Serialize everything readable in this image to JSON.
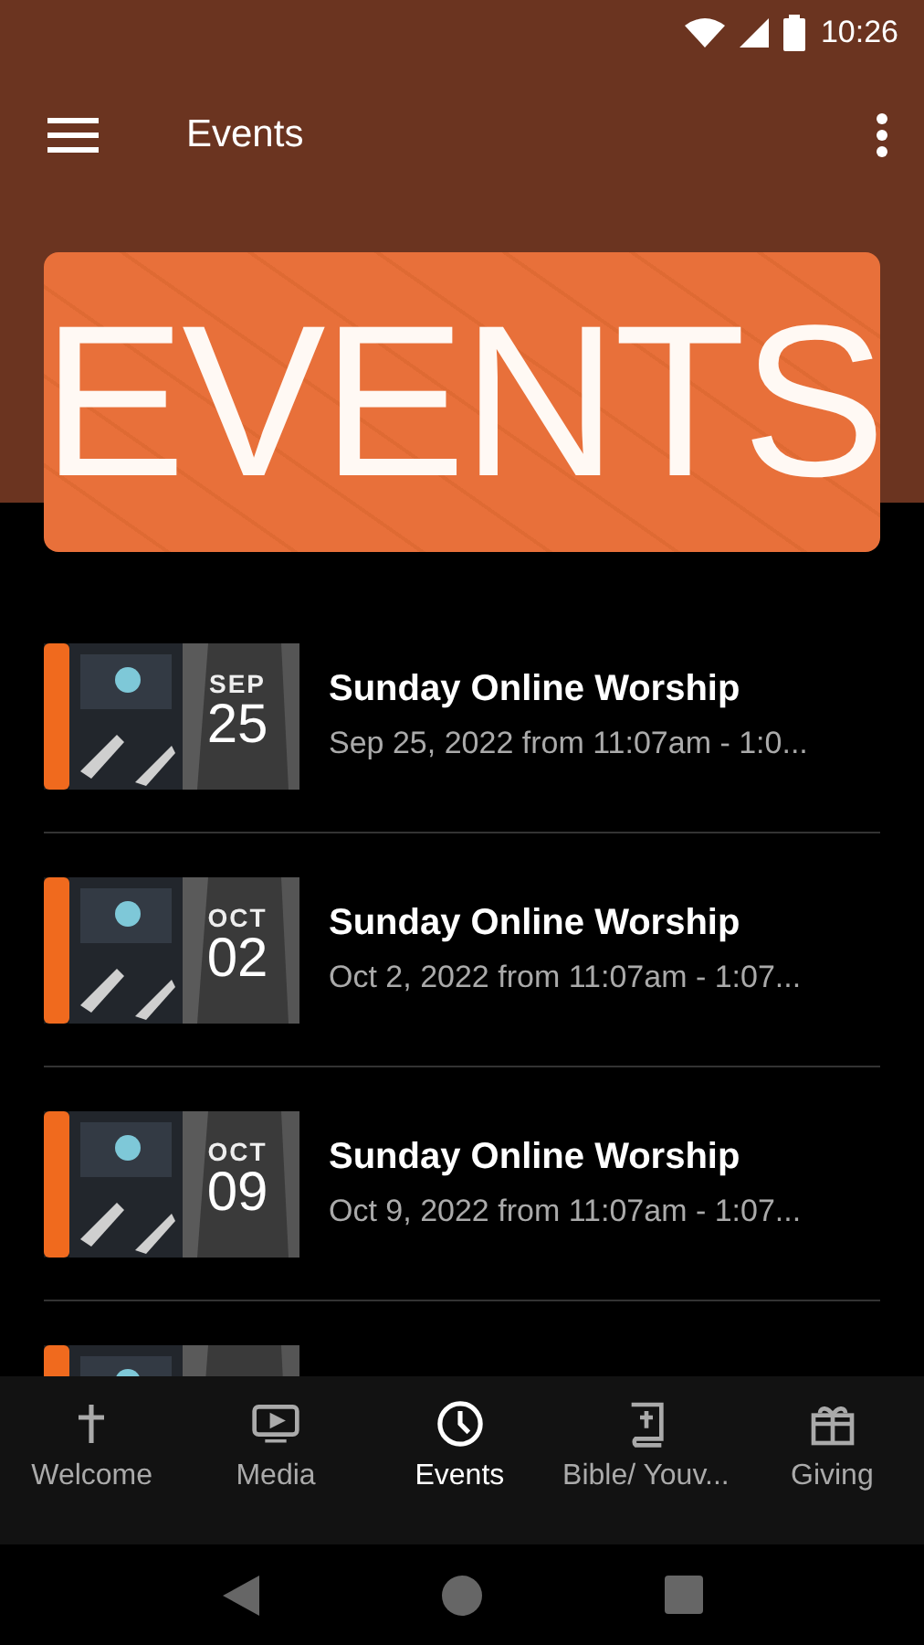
{
  "status_bar": {
    "time": "10:26"
  },
  "app_bar": {
    "title": "Events"
  },
  "banner": {
    "text": "EVENTS"
  },
  "events": [
    {
      "month": "SEP",
      "day": "25",
      "title": "Sunday Online Worship",
      "when": "Sep 25, 2022 from 11:07am - 1:0..."
    },
    {
      "month": "OCT",
      "day": "02",
      "title": "Sunday Online Worship",
      "when": "Oct 2, 2022 from 11:07am - 1:07..."
    },
    {
      "month": "OCT",
      "day": "09",
      "title": "Sunday Online Worship",
      "when": "Oct 9, 2022 from 11:07am - 1:07..."
    }
  ],
  "bottom_nav": [
    {
      "label": "Welcome",
      "selected": false
    },
    {
      "label": "Media",
      "selected": false
    },
    {
      "label": "Events",
      "selected": true
    },
    {
      "label": "Bible/ Youv...",
      "selected": false
    },
    {
      "label": "Giving",
      "selected": false
    }
  ]
}
